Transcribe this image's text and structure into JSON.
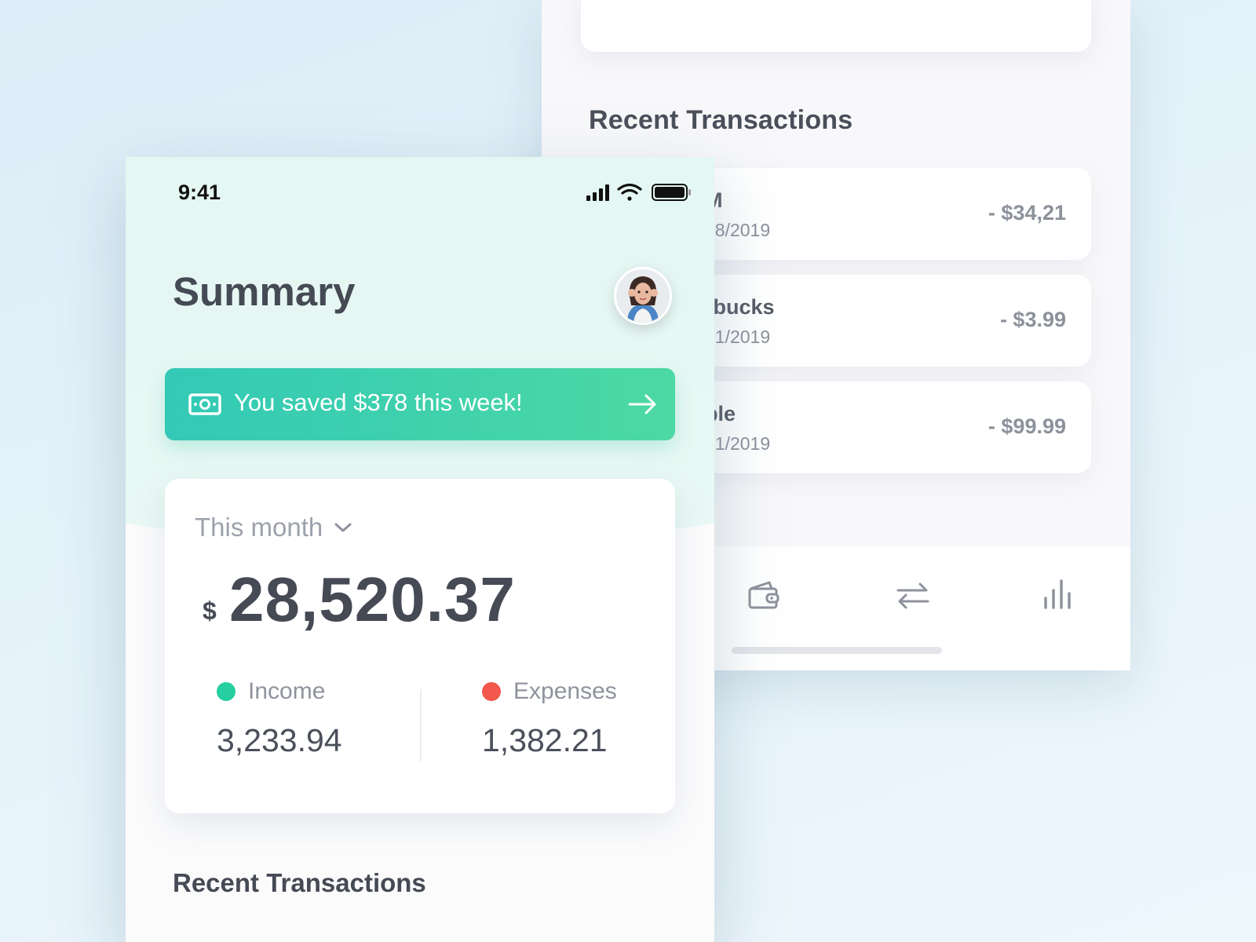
{
  "back_screen": {
    "recent_title": "Recent Transactions",
    "transactions": [
      {
        "name": "M",
        "date": "08/2019",
        "amount": "- $34,21"
      },
      {
        "name": "rbucks",
        "date": "21/2019",
        "amount": "- $3.99"
      },
      {
        "name": "ple",
        "date": "21/2019",
        "amount": "- $99.99"
      }
    ],
    "nav": [
      "wallet-icon",
      "transfer-icon",
      "stats-icon"
    ]
  },
  "front_screen": {
    "status_bar": {
      "time": "9:41"
    },
    "title": "Summary",
    "savings_banner": {
      "text": "You saved $378 this week!"
    },
    "summary": {
      "period": "This month",
      "currency": "$",
      "balance": "28,520.37",
      "income": {
        "label": "Income",
        "value": "3,233.94",
        "color": "#25cfa2"
      },
      "expenses": {
        "label": "Expenses",
        "value": "1,382.21",
        "color": "#f4574b"
      }
    },
    "recent_title": "Recent Transactions"
  },
  "colors": {
    "accent_gradient_start": "#33c9b6",
    "accent_gradient_end": "#4cd9a3",
    "text_dark": "#454a55",
    "text_muted": "#9ca1ab"
  }
}
